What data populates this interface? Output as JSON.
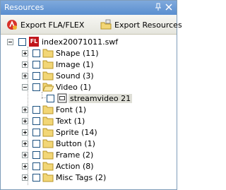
{
  "panel": {
    "title": "Resources"
  },
  "toolbar": {
    "export_fla_label": "Export FLA/FLEX",
    "export_resources_label": "Export Resources"
  },
  "tree": {
    "root": {
      "badge": "FL",
      "label": "index20071011.swf"
    },
    "nodes": [
      {
        "label": "Shape (11)"
      },
      {
        "label": "Image (1)"
      },
      {
        "label": "Sound (3)"
      },
      {
        "label": "Video (1)"
      },
      {
        "label": "Font (1)"
      },
      {
        "label": "Text (1)"
      },
      {
        "label": "Sprite (14)"
      },
      {
        "label": "Button (1)"
      },
      {
        "label": "Frame (2)"
      },
      {
        "label": "Action (8)"
      },
      {
        "label": "Misc Tags (2)"
      }
    ],
    "video_child": {
      "label": "streamvideo 21"
    }
  },
  "colors": {
    "titlebar": "#6b9bd8",
    "folder": "#f2d676",
    "selection": "#dfdfd7"
  }
}
